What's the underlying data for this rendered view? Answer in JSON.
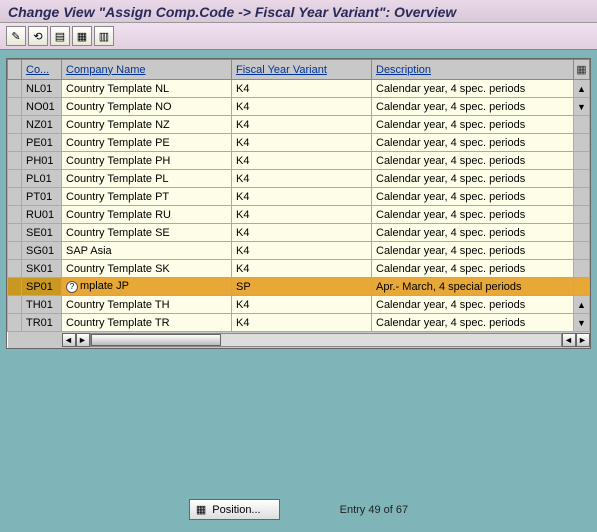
{
  "title": "Change View \"Assign Comp.Code -> Fiscal Year Variant\": Overview",
  "toolbar": {
    "b1": "✎",
    "b2": "⟲",
    "b3": "▤",
    "b4": "▦",
    "b5": "▥"
  },
  "columns": {
    "code": "Co...",
    "name": "Company Name",
    "variant": "Fiscal Year Variant",
    "desc": "Description"
  },
  "rows": [
    {
      "code": "NL01",
      "name": "Country Template NL",
      "variant": "K4",
      "desc": "Calendar year, 4 spec. periods",
      "selected": false
    },
    {
      "code": "NO01",
      "name": "Country Template NO",
      "variant": "K4",
      "desc": "Calendar year, 4 spec. periods",
      "selected": false
    },
    {
      "code": "NZ01",
      "name": "Country Template NZ",
      "variant": "K4",
      "desc": "Calendar year, 4 spec. periods",
      "selected": false
    },
    {
      "code": "PE01",
      "name": "Country Template PE",
      "variant": "K4",
      "desc": "Calendar year, 4 spec. periods",
      "selected": false
    },
    {
      "code": "PH01",
      "name": "Country Template PH",
      "variant": "K4",
      "desc": "Calendar year, 4 spec. periods",
      "selected": false
    },
    {
      "code": "PL01",
      "name": "Country Template PL",
      "variant": "K4",
      "desc": "Calendar year, 4 spec. periods",
      "selected": false
    },
    {
      "code": "PT01",
      "name": "Country Template PT",
      "variant": "K4",
      "desc": "Calendar year, 4 spec. periods",
      "selected": false
    },
    {
      "code": "RU01",
      "name": "Country Template RU",
      "variant": "K4",
      "desc": "Calendar year, 4 spec. periods",
      "selected": false
    },
    {
      "code": "SE01",
      "name": "Country Template SE",
      "variant": "K4",
      "desc": "Calendar year, 4 spec. periods",
      "selected": false
    },
    {
      "code": "SG01",
      "name": "SAP Asia",
      "variant": "K4",
      "desc": "Calendar year, 4 spec. periods",
      "selected": false
    },
    {
      "code": "SK01",
      "name": "Country Template SK",
      "variant": "K4",
      "desc": "Calendar year, 4 spec. periods",
      "selected": false
    },
    {
      "code": "SP01",
      "name": "mplate JP",
      "variant": "SP",
      "desc": "Apr.- March, 4 special periods",
      "selected": true
    },
    {
      "code": "TH01",
      "name": "Country Template TH",
      "variant": "K4",
      "desc": "Calendar year, 4 spec. periods",
      "selected": false
    },
    {
      "code": "TR01",
      "name": "Country Template TR",
      "variant": "K4",
      "desc": "Calendar year, 4 spec. periods",
      "selected": false
    }
  ],
  "footer": {
    "position_label": "Position...",
    "entry_label": "Entry 49 of 67"
  }
}
